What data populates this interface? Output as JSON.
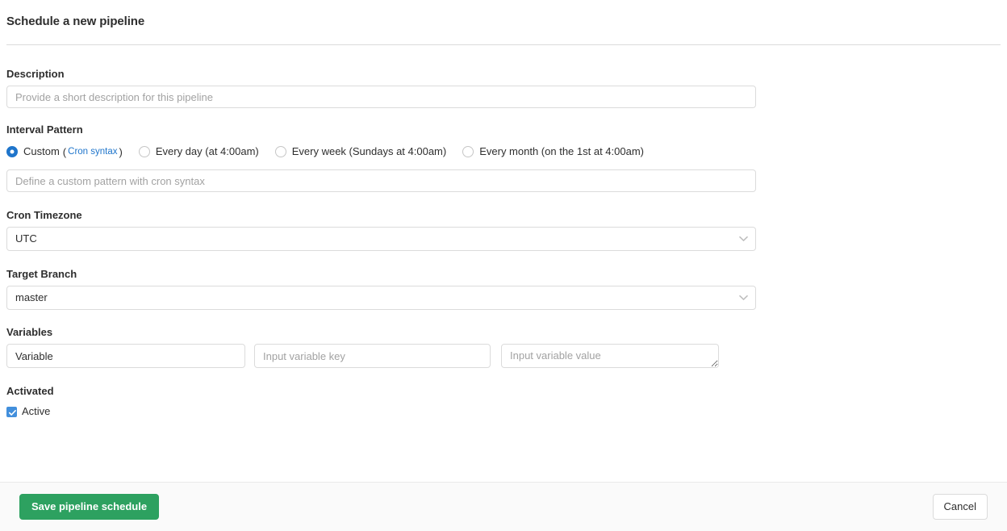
{
  "page": {
    "title": "Schedule a new pipeline"
  },
  "description": {
    "label": "Description",
    "placeholder": "Provide a short description for this pipeline",
    "value": ""
  },
  "interval": {
    "label": "Interval Pattern",
    "selected": "custom",
    "options": [
      {
        "id": "custom",
        "label": "Custom",
        "link_text": "Cron syntax",
        "open_paren": "(",
        "close_paren": ")",
        "checked": true
      },
      {
        "id": "every-day",
        "label": "Every day (at 4:00am)",
        "checked": false
      },
      {
        "id": "every-week",
        "label": "Every week (Sundays at 4:00am)",
        "checked": false
      },
      {
        "id": "every-month",
        "label": "Every month (on the 1st at 4:00am)",
        "checked": false
      }
    ],
    "custom_placeholder": "Define a custom pattern with cron syntax",
    "custom_value": ""
  },
  "timezone": {
    "label": "Cron Timezone",
    "value": "UTC",
    "icon": "chevron-down-icon"
  },
  "branch": {
    "label": "Target Branch",
    "value": "master",
    "icon": "chevron-down-icon"
  },
  "variables": {
    "label": "Variables",
    "rows": [
      {
        "type_value": "Variable",
        "key_placeholder": "Input variable key",
        "key_value": "",
        "value_placeholder": "Input variable value",
        "value_value": ""
      }
    ]
  },
  "activated": {
    "label": "Activated",
    "checkbox_label": "Active",
    "checked": true
  },
  "footer": {
    "save_label": "Save pipeline schedule",
    "cancel_label": "Cancel"
  },
  "colors": {
    "accent_blue": "#1f75cb",
    "checkbox_blue": "#428fdc",
    "save_green": "#2da160",
    "border": "#dbdbdb",
    "text": "#2e2e2e",
    "placeholder": "#a2a2a2",
    "footer_bg": "#fafafa"
  }
}
